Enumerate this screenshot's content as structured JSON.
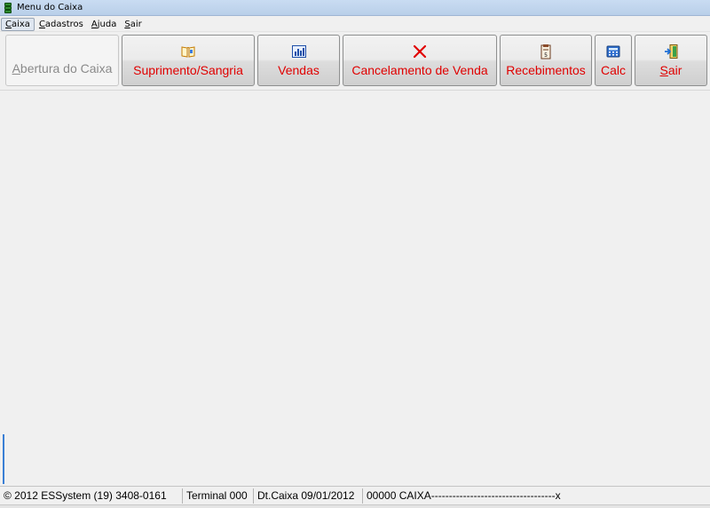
{
  "window": {
    "title": "Menu do Caixa",
    "app_icon": "cash-stack-icon"
  },
  "menubar": {
    "items": [
      {
        "label_first": "C",
        "label_rest": "aixa",
        "underline_index": 0
      },
      {
        "label_first": "C",
        "label_rest": "adastros"
      },
      {
        "label_first": "A",
        "label_rest": "juda"
      },
      {
        "label_first": "S",
        "label_rest": "air"
      }
    ]
  },
  "toolbar": {
    "abertura": {
      "label_first": "A",
      "label_rest": "bertura do Caixa",
      "enabled": false
    },
    "suprimento": {
      "label": "Suprimento/Sangria",
      "icon": "open-book-icon"
    },
    "vendas": {
      "label": "Vendas",
      "icon": "bar-chart-icon"
    },
    "cancelamento": {
      "label": "Cancelamento de Venda",
      "icon": "red-x-icon"
    },
    "recebimentos": {
      "label": "Recebimentos",
      "icon": "calendar-clipboard-icon"
    },
    "calc": {
      "label": "Calc",
      "icon": "calculator-icon"
    },
    "sair": {
      "label_first": "S",
      "label_rest": "air",
      "icon": "exit-door-icon"
    }
  },
  "statusbar": {
    "copyright": "© 2012 ESSystem (19) 3408-0161",
    "terminal": "Terminal 000",
    "dt_caixa": "Dt.Caixa 09/01/2012",
    "caixa_status": "00000 CAIXA-----------------------------------x"
  },
  "colors": {
    "button_text": "#e00000",
    "disabled_text": "#8a8a8a",
    "title_bar": "#c9dcf2"
  }
}
